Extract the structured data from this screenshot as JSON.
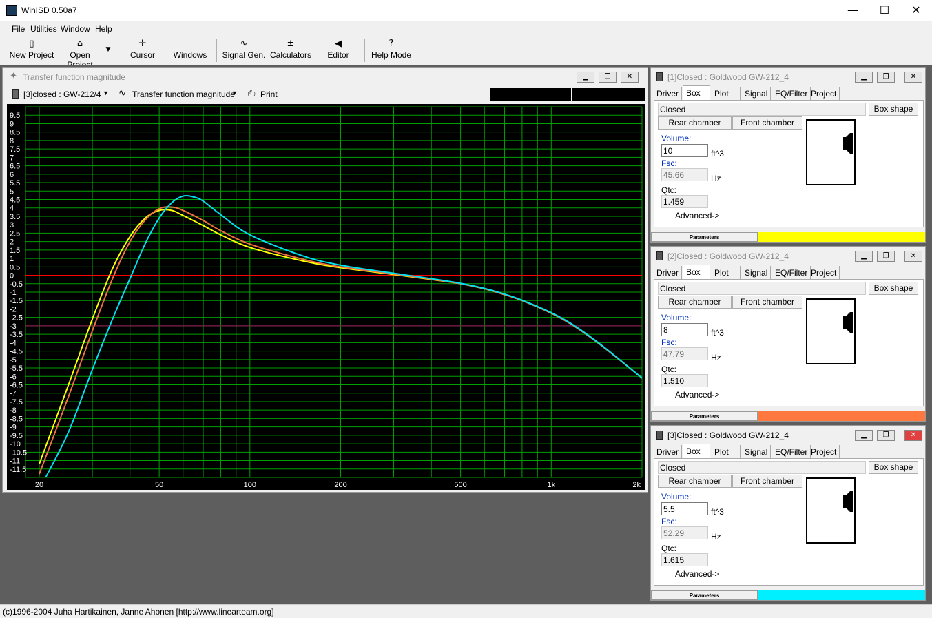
{
  "app": {
    "title": "WinISD 0.50a7",
    "window_controls": {
      "minimize": "—",
      "maximize": "☐",
      "close": "✕"
    }
  },
  "menu": [
    "File",
    "Utilities",
    "Window",
    "Help"
  ],
  "toolbar": {
    "new_project": "New Project",
    "open_project": "Open Project",
    "cursor": "Cursor",
    "windows": "Windows",
    "signal_gen": "Signal Gen.",
    "calculators": "Calculators",
    "editor": "Editor",
    "help_mode": "Help Mode"
  },
  "graph_window": {
    "title": "Transfer function magnitude",
    "project_select": "[3]closed : GW-212/4",
    "plot_select": "Transfer function magnitude",
    "print": "Print"
  },
  "chart_data": {
    "type": "line",
    "xscale": "log",
    "xlim": [
      18,
      2000
    ],
    "ylim": [
      -12,
      10
    ],
    "grid": true,
    "xticks": [
      "20",
      "50",
      "100",
      "200",
      "500",
      "1k",
      "2k"
    ],
    "yticks": [
      "9.5",
      "9",
      "8.5",
      "8",
      "7.5",
      "7",
      "6.5",
      "6",
      "5.5",
      "5",
      "4.5",
      "4",
      "3.5",
      "3",
      "2.5",
      "2",
      "1.5",
      "1",
      "0.5",
      "0",
      "-0.5",
      "-1",
      "-1.5",
      "-2",
      "-2.5",
      "-3",
      "-3.5",
      "-4",
      "-4.5",
      "-5",
      "-5.5",
      "-6",
      "-6.5",
      "-7",
      "-7.5",
      "-8",
      "-8.5",
      "-9",
      "-9.5",
      "-10",
      "-10.5",
      "-11",
      "-11.5"
    ],
    "reference_lines": [
      {
        "y": 0,
        "color": "#ff0000"
      },
      {
        "y": -3,
        "color": "#a01060"
      }
    ],
    "series": [
      {
        "color": "#ffff00",
        "x": [
          20,
          25,
          30,
          35,
          40,
          45,
          50,
          55,
          60,
          70,
          80,
          100,
          150,
          200,
          300,
          400,
          500,
          600,
          700,
          800,
          1000,
          1200,
          1500,
          2000
        ],
        "y": [
          -11.2,
          -6.5,
          -2.6,
          0.4,
          2.3,
          3.4,
          3.85,
          3.85,
          3.55,
          2.95,
          2.4,
          1.65,
          0.85,
          0.45,
          0.05,
          -0.25,
          -0.5,
          -0.8,
          -1.15,
          -1.5,
          -2.25,
          -3.05,
          -4.3,
          -6.1
        ]
      },
      {
        "color": "#f07040",
        "x": [
          20,
          25,
          30,
          35,
          40,
          45,
          50,
          55,
          60,
          70,
          80,
          100,
          150,
          200,
          300,
          400,
          500,
          600,
          700,
          800,
          1000,
          1200,
          1500,
          2000
        ],
        "y": [
          -11.8,
          -7.2,
          -3.3,
          -0.2,
          2.0,
          3.3,
          3.95,
          4.05,
          3.85,
          3.25,
          2.65,
          1.85,
          0.95,
          0.5,
          0.08,
          -0.23,
          -0.5,
          -0.8,
          -1.15,
          -1.5,
          -2.25,
          -3.05,
          -4.3,
          -6.1
        ]
      },
      {
        "color": "#00e0f0",
        "x": [
          21,
          25,
          30,
          35,
          40,
          45,
          50,
          55,
          60,
          65,
          70,
          80,
          100,
          150,
          200,
          300,
          400,
          500,
          600,
          700,
          800,
          1000,
          1200,
          1500,
          2000
        ],
        "y": [
          -12,
          -9.3,
          -5.6,
          -2.6,
          -0.2,
          1.9,
          3.4,
          4.3,
          4.7,
          4.65,
          4.4,
          3.6,
          2.4,
          1.15,
          0.6,
          0.12,
          -0.2,
          -0.48,
          -0.78,
          -1.12,
          -1.48,
          -2.22,
          -3.02,
          -4.28,
          -6.1
        ]
      }
    ]
  },
  "box_windows": [
    {
      "title": "[1]Closed : Goldwood  GW-212_4",
      "volume": "10",
      "fsc": "45.66",
      "qtc": "1.459",
      "color": "#ffff00"
    },
    {
      "title": "[2]Closed : Goldwood  GW-212_4",
      "volume": "8",
      "fsc": "47.79",
      "qtc": "1.510",
      "color": "#ff7840"
    },
    {
      "title": "[3]Closed : Goldwood  GW-212_4",
      "volume": "5.5",
      "fsc": "52.29",
      "qtc": "1.615",
      "color": "#00f0ff"
    }
  ],
  "box_labels": {
    "tabs": [
      "Driver",
      "Box",
      "Plot",
      "Signal",
      "EQ/Filter",
      "Project"
    ],
    "box_type": "Closed",
    "box_shape": "Box shape",
    "rear_chamber": "Rear chamber",
    "front_chamber": "Front chamber",
    "volume": "Volume:",
    "fsc": "Fsc:",
    "qtc": "Qtc:",
    "volume_unit": "ft^3",
    "fsc_unit": "Hz",
    "advanced": "Advanced->",
    "parameters": "Parameters"
  },
  "status": "(c)1996-2004 Juha Hartikainen, Janne Ahonen [http://www.linearteam.org]"
}
